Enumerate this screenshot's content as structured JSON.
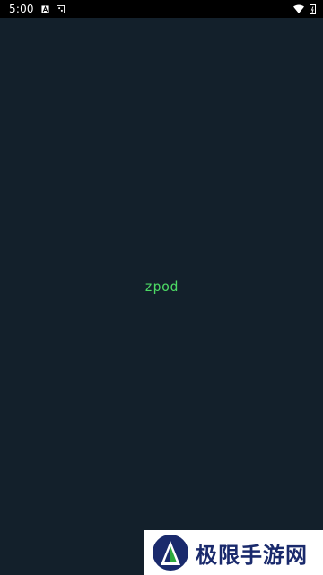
{
  "status_bar": {
    "time": "5:00",
    "icons": [
      "notification-a-icon",
      "notification-sim-icon",
      "wifi-icon",
      "battery-icon"
    ]
  },
  "app": {
    "title": "zpod",
    "title_color": "#4cd964",
    "background_color": "#13202b"
  },
  "watermark": {
    "text": "极限手游网",
    "logo": "jixian-logo-icon",
    "text_color": "#1a2a6c"
  }
}
